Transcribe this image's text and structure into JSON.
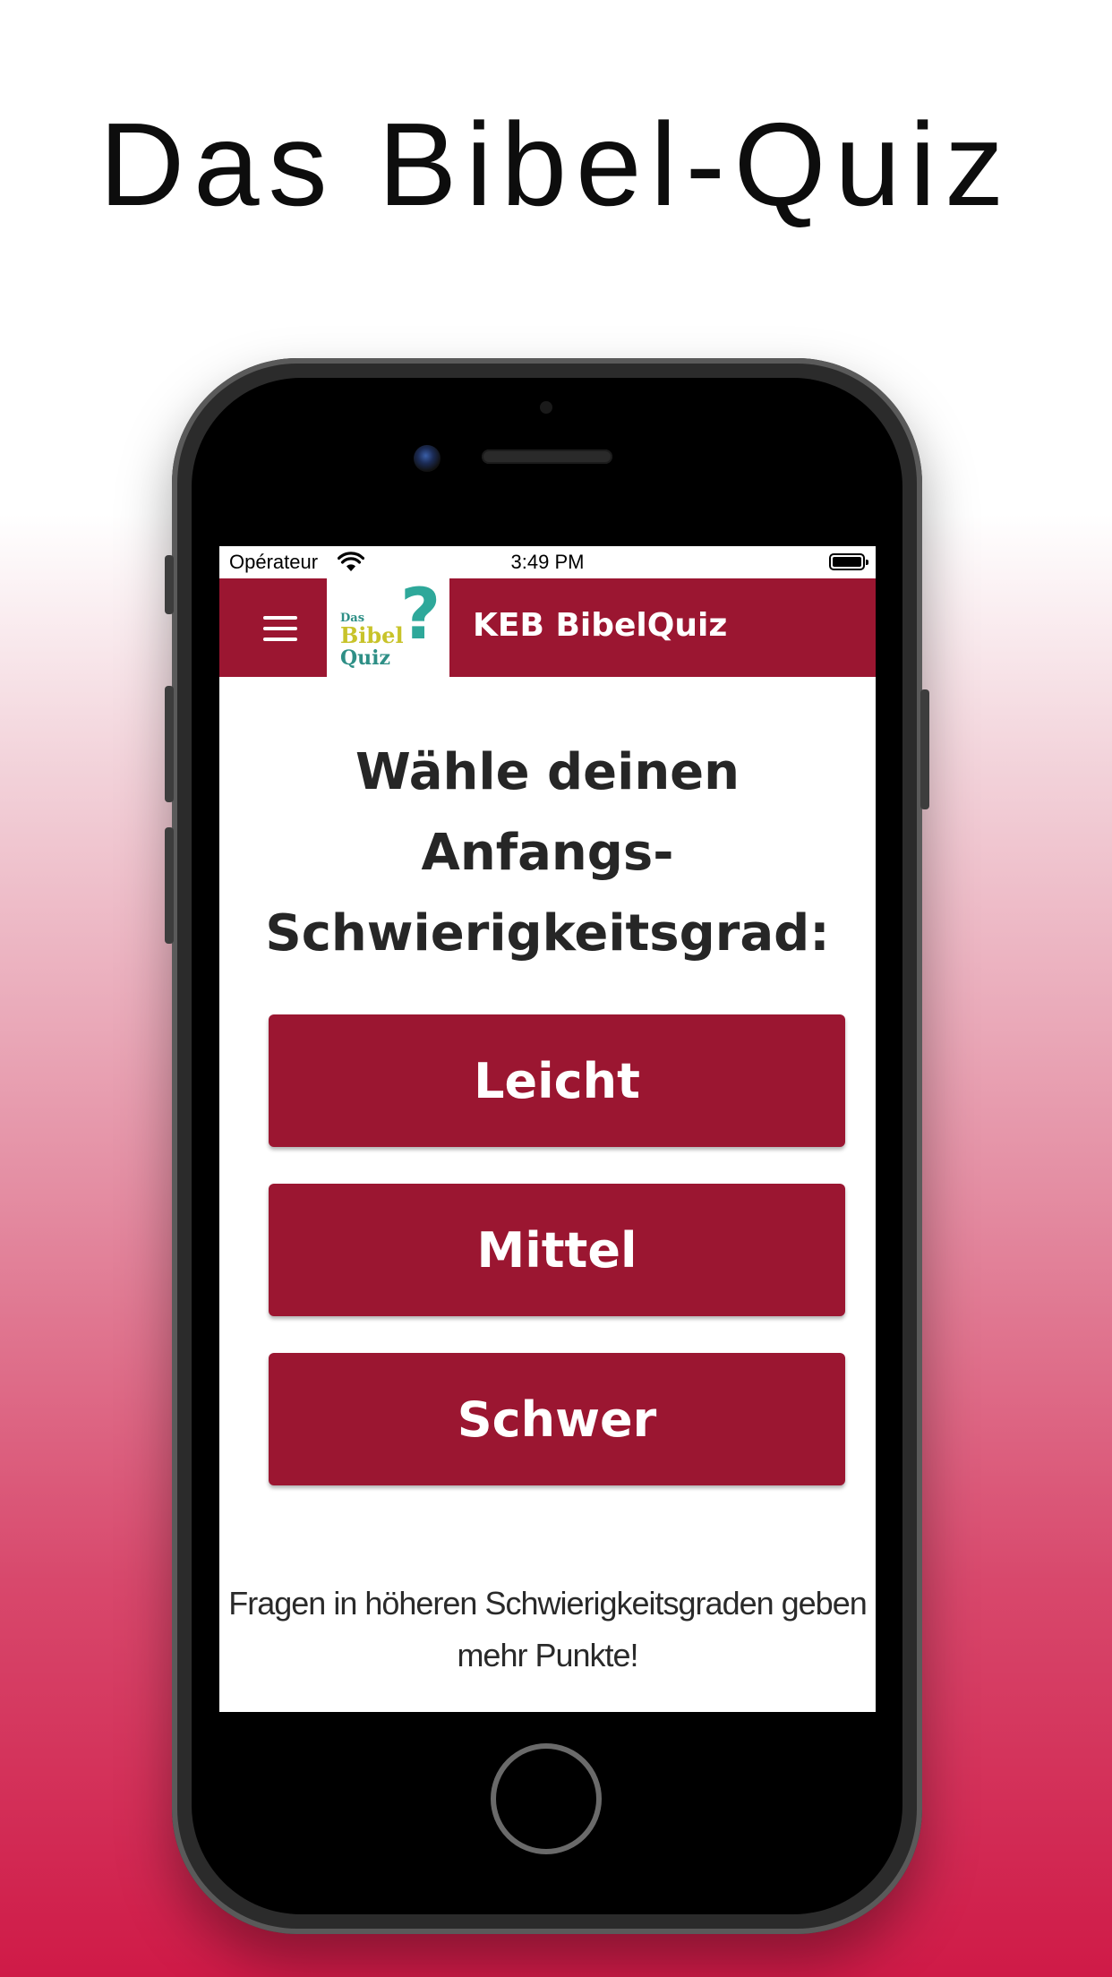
{
  "promo": {
    "title": "Das Bibel-Quiz"
  },
  "status_bar": {
    "carrier": "Opérateur",
    "time": "3:49 PM"
  },
  "app_bar": {
    "title": "KEB BibelQuiz",
    "logo": {
      "line1": "Das",
      "line2": "Bibel",
      "line3": "Quiz",
      "mark": "?"
    }
  },
  "main": {
    "prompt_line1": "Wähle deinen",
    "prompt_line2": "Anfangs-",
    "prompt_line3": "Schwierigkeitsgrad:",
    "levels": [
      {
        "label": "Leicht"
      },
      {
        "label": "Mittel"
      },
      {
        "label": "Schwer"
      }
    ],
    "note_line1": "Fragen in höheren Schwierigkeitsgraden geben",
    "note_line2": "mehr Punkte!"
  },
  "colors": {
    "brand": "#9b1631",
    "background_bottom": "#cf1a47"
  },
  "icons": [
    "menu-icon",
    "wifi-icon",
    "battery-icon"
  ]
}
